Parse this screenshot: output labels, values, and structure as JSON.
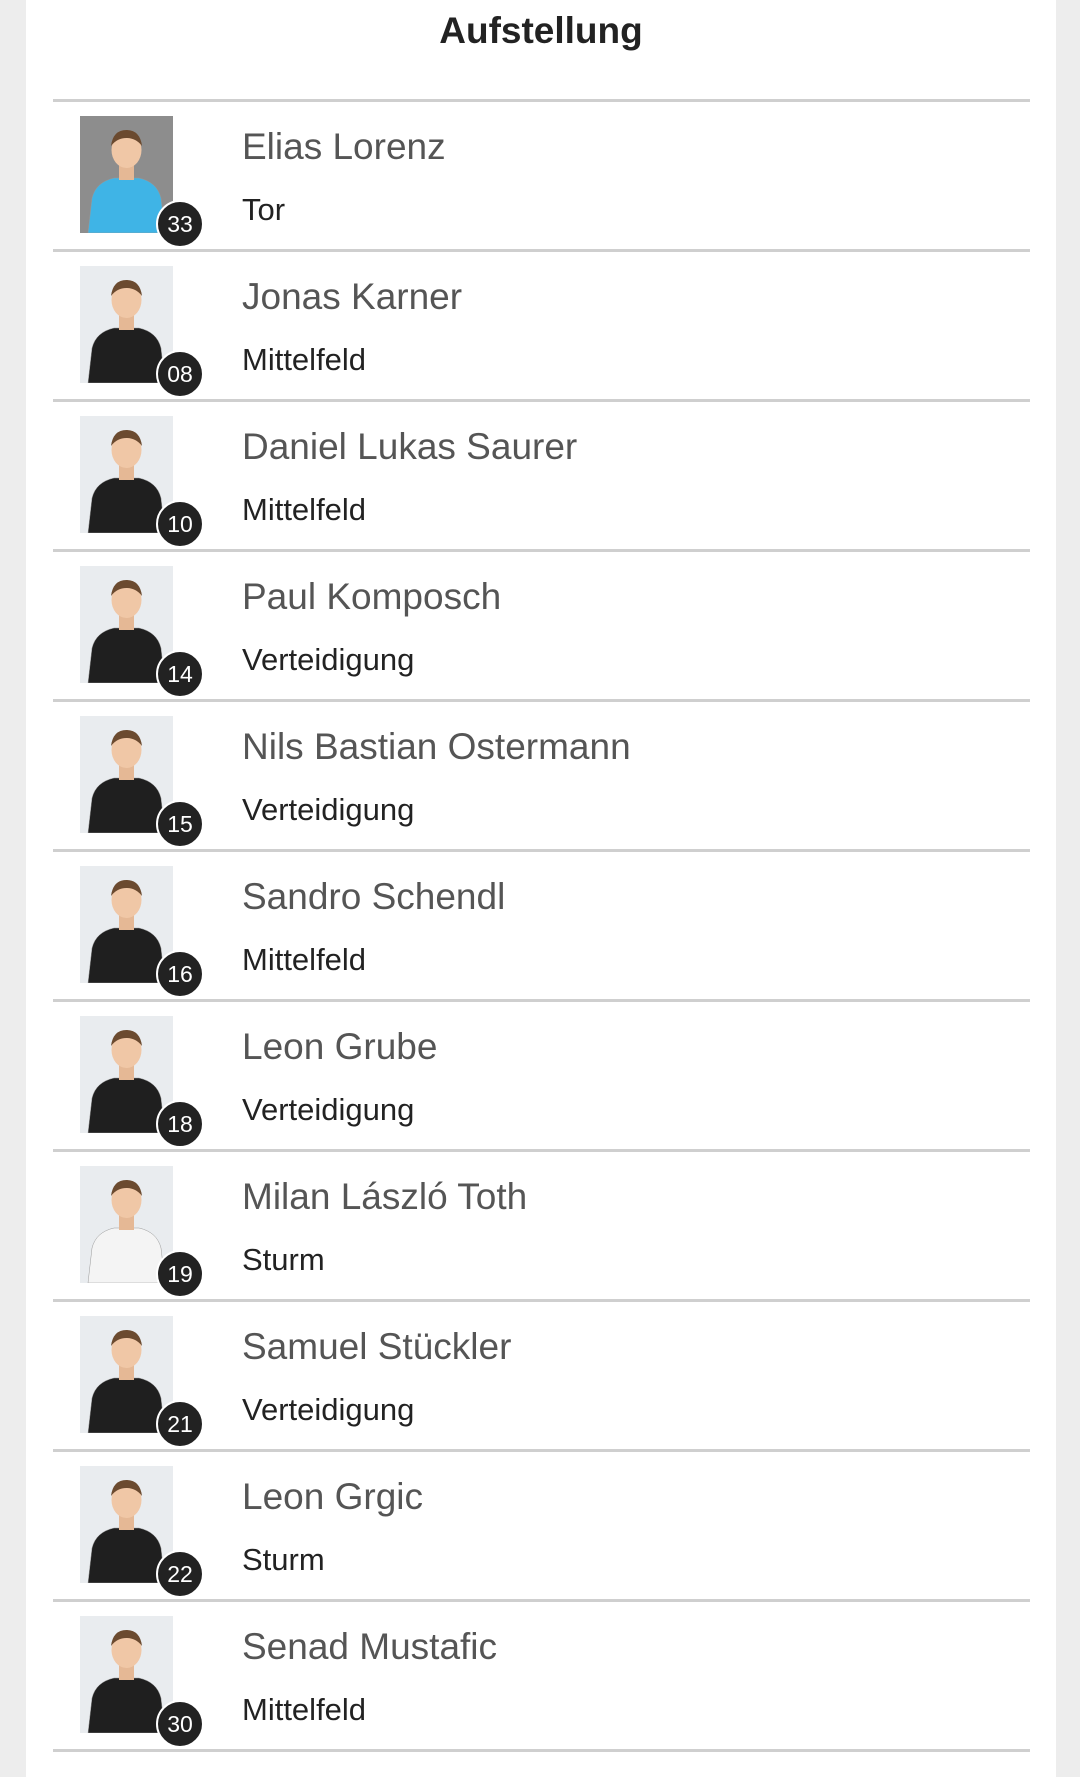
{
  "page": {
    "title": "Aufstellung"
  },
  "players": [
    {
      "name": "Elias Lorenz",
      "position": "Tor",
      "number": "33",
      "kit": "goalkeeper-blue"
    },
    {
      "name": "Jonas Karner",
      "position": "Mittelfeld",
      "number": "08",
      "kit": "black"
    },
    {
      "name": "Daniel Lukas Saurer",
      "position": "Mittelfeld",
      "number": "10",
      "kit": "black"
    },
    {
      "name": "Paul Komposch",
      "position": "Verteidigung",
      "number": "14",
      "kit": "black"
    },
    {
      "name": "Nils Bastian Ostermann",
      "position": "Verteidigung",
      "number": "15",
      "kit": "black"
    },
    {
      "name": "Sandro Schendl",
      "position": "Mittelfeld",
      "number": "16",
      "kit": "black"
    },
    {
      "name": "Leon Grube",
      "position": "Verteidigung",
      "number": "18",
      "kit": "black"
    },
    {
      "name": "Milan László Toth",
      "position": "Sturm",
      "number": "19",
      "kit": "white"
    },
    {
      "name": "Samuel Stückler",
      "position": "Verteidigung",
      "number": "21",
      "kit": "black"
    },
    {
      "name": "Leon Grgic",
      "position": "Sturm",
      "number": "22",
      "kit": "black"
    },
    {
      "name": "Senad Mustafic",
      "position": "Mittelfeld",
      "number": "30",
      "kit": "black"
    }
  ],
  "colors": {
    "background": "#ededed",
    "card": "#ffffff",
    "divider": "#cfcfcf",
    "badge": "#222222",
    "name_text": "#555555",
    "position_text": "#222222",
    "goalkeeper_kit": "#3fb4e6",
    "black_kit": "#1f1f1f",
    "white_kit": "#f4f4f4"
  }
}
